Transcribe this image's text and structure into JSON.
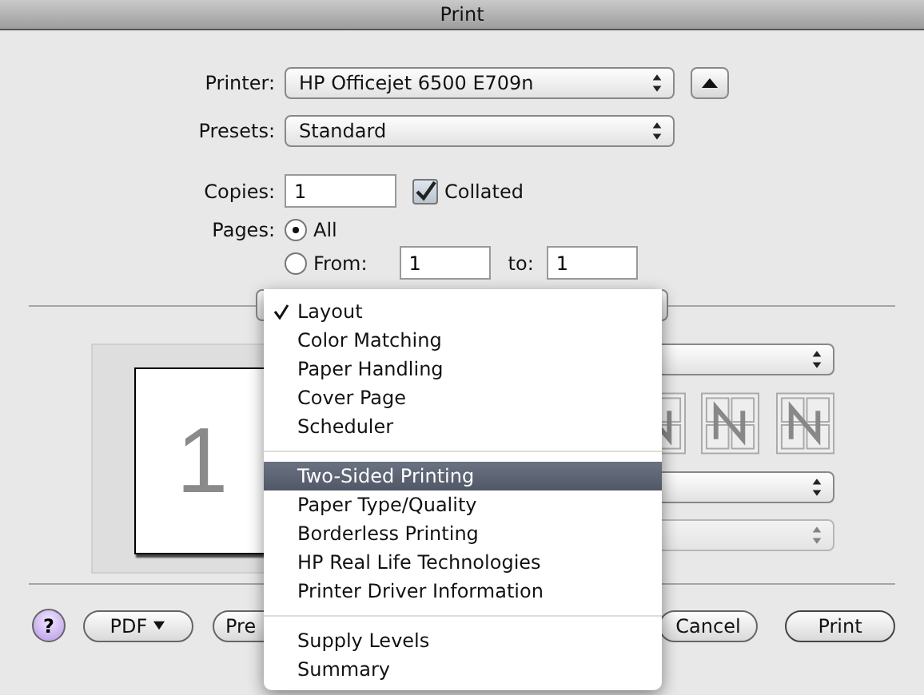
{
  "window": {
    "title": "Print"
  },
  "printer": {
    "label": "Printer:",
    "value": "HP Officejet 6500 E709n"
  },
  "presets": {
    "label": "Presets:",
    "value": "Standard"
  },
  "copies": {
    "label": "Copies:",
    "value": "1",
    "collated": {
      "label": "Collated",
      "checked": true
    }
  },
  "pages": {
    "label": "Pages:",
    "options": [
      {
        "label": "All",
        "selected": true
      },
      {
        "label": "From:",
        "selected": false
      }
    ],
    "from": "1",
    "to_label": "to:",
    "to": "1"
  },
  "preview": {
    "page_number": "1"
  },
  "settings_popups": [
    {
      "disabled": false
    },
    {
      "disabled": false
    },
    {
      "disabled": true
    }
  ],
  "menu": {
    "groups": [
      [
        {
          "label": "Layout",
          "checked": true,
          "selected": false
        },
        {
          "label": "Color Matching",
          "checked": false,
          "selected": false
        },
        {
          "label": "Paper Handling",
          "checked": false,
          "selected": false
        },
        {
          "label": "Cover Page",
          "checked": false,
          "selected": false
        },
        {
          "label": "Scheduler",
          "checked": false,
          "selected": false
        }
      ],
      [
        {
          "label": "Two-Sided Printing",
          "checked": false,
          "selected": true
        },
        {
          "label": "Paper Type/Quality",
          "checked": false,
          "selected": false
        },
        {
          "label": "Borderless Printing",
          "checked": false,
          "selected": false
        },
        {
          "label": "HP Real Life Technologies",
          "checked": false,
          "selected": false
        },
        {
          "label": "Printer Driver Information",
          "checked": false,
          "selected": false
        }
      ],
      [
        {
          "label": "Supply Levels",
          "checked": false,
          "selected": false
        },
        {
          "label": "Summary",
          "checked": false,
          "selected": false
        }
      ]
    ]
  },
  "buttons": {
    "help": "?",
    "pdf": "PDF",
    "preview": "Pre",
    "cancel": "Cancel",
    "print": "Print"
  }
}
